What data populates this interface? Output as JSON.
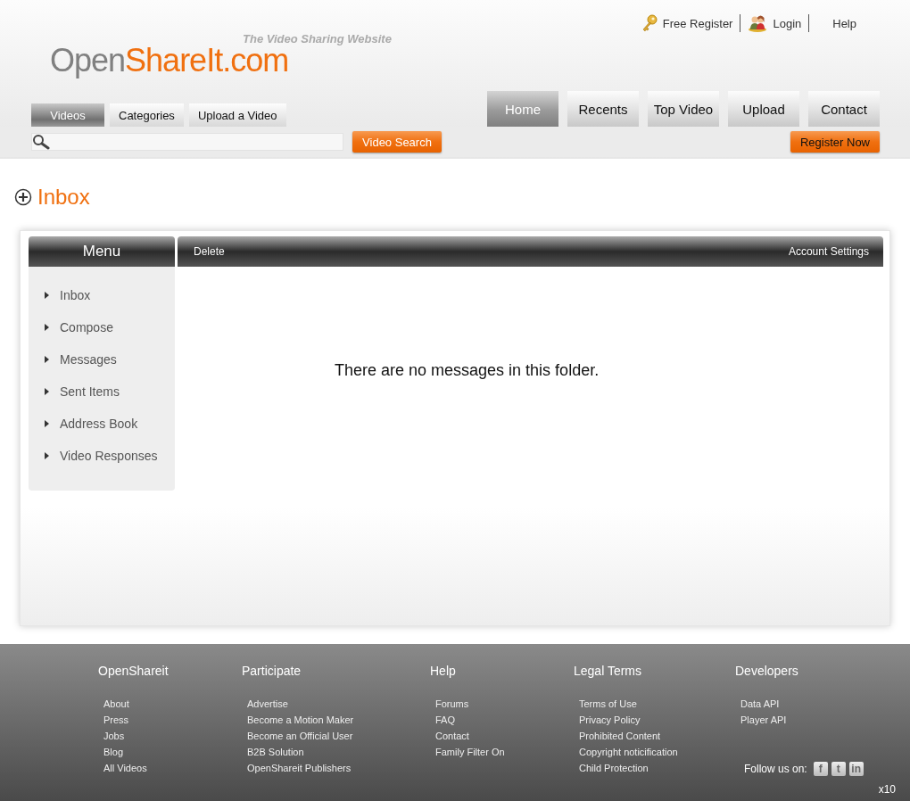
{
  "top_links": [
    {
      "label": "Free Register",
      "kind": "key"
    },
    {
      "label": "Login",
      "kind": "user"
    },
    {
      "label": "Help",
      "kind": "plain"
    }
  ],
  "logo": {
    "parts": [
      {
        "text": "Open",
        "kind": "plain"
      },
      {
        "text": "ShareIt.com",
        "kind": "accent"
      }
    ],
    "tagline": "The Video Sharing Website"
  },
  "section_tabs": [
    {
      "label": "Videos",
      "selected": true
    },
    {
      "label": "Categories",
      "selected": false
    },
    {
      "label": "Upload a Video",
      "selected": false
    }
  ],
  "main_nav": [
    {
      "label": "Home",
      "selected": true
    },
    {
      "label": "Recents",
      "selected": false
    },
    {
      "label": "Top Video",
      "selected": false
    },
    {
      "label": "Upload",
      "selected": false
    },
    {
      "label": "Contact",
      "selected": false
    }
  ],
  "search": {
    "button": "Video Search"
  },
  "register_button": "Register Now",
  "page_title": "Inbox",
  "menu": {
    "title": "Menu",
    "items": [
      "Inbox",
      "Compose",
      "Messages",
      "Sent Items",
      "Address Book",
      "Video Responses"
    ]
  },
  "toolbar": {
    "left": "Delete",
    "right": "Account Settings"
  },
  "empty_message": "There are no messages in this folder.",
  "footer": {
    "columns": [
      {
        "title": "OpenShareit",
        "links": [
          "About",
          "Press",
          "Jobs",
          "Blog",
          "All Videos"
        ]
      },
      {
        "title": "Participate",
        "links": [
          "Advertise",
          "Become a Motion Maker",
          "Become an Official User",
          "B2B Solution",
          "OpenShareit Publishers"
        ]
      },
      {
        "title": "Help",
        "links": [
          "Forums",
          "FAQ",
          "Contact",
          "Family Filter On"
        ]
      },
      {
        "title": "Legal Terms",
        "links": [
          "Terms of Use",
          "Privacy Policy",
          "Prohibited Content",
          "Copyright noticification",
          "Child Protection"
        ]
      },
      {
        "title": "Developers",
        "links": [
          "Data API",
          "Player API"
        ]
      }
    ],
    "follow_label": "Follow us on:",
    "social": [
      "f",
      "t",
      "in"
    ],
    "counter": "x10"
  }
}
